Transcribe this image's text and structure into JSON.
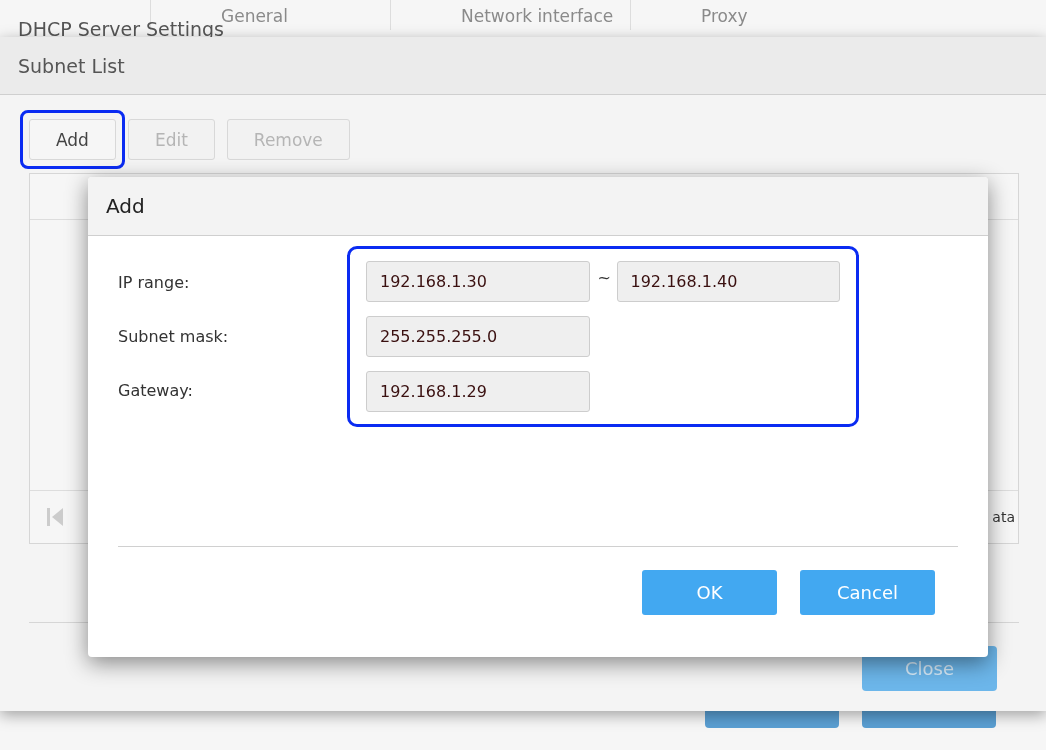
{
  "background_window": {
    "title": "DHCP Server Settings",
    "tabs": [
      {
        "label": "General"
      },
      {
        "label": "Network interface"
      },
      {
        "label": "Proxy"
      }
    ]
  },
  "subnet_dialog": {
    "title": "Subnet List",
    "toolbar": [
      {
        "label": "Add",
        "disabled": false,
        "highlighted": true
      },
      {
        "label": "Edit",
        "disabled": true,
        "highlighted": false
      },
      {
        "label": "Remove",
        "disabled": true,
        "highlighted": false
      }
    ],
    "table": {
      "footer_text": "ata"
    },
    "buttons": [
      "Close"
    ]
  },
  "add_dialog": {
    "title": "Add",
    "fields_highlighted": true,
    "fields": [
      {
        "label": "IP range:",
        "values": [
          "192.168.1.30",
          "192.168.1.40"
        ],
        "separator": "~"
      },
      {
        "label": "Subnet mask:",
        "values": [
          "255.255.255.0"
        ]
      },
      {
        "label": "Gateway:",
        "values": [
          "192.168.1.29"
        ]
      }
    ],
    "buttons": [
      "OK",
      "Cancel"
    ]
  }
}
